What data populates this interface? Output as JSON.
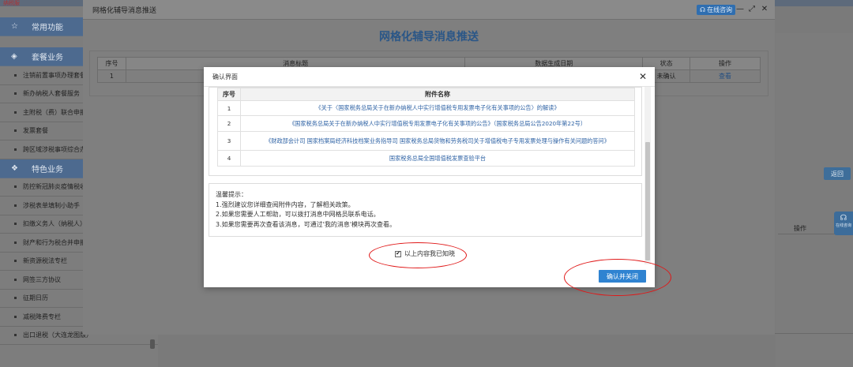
{
  "topbar": {
    "brand_fragment": "纳税服"
  },
  "sidebar": {
    "groups": [
      {
        "label": "常用功能",
        "icon": "star-icon"
      },
      {
        "label": "套餐业务",
        "icon": "package-icon"
      },
      {
        "label": "特色业务",
        "icon": "settings-icon"
      }
    ],
    "package_items": [
      "注销前置事项办理套餐",
      "新办纳税人套餐服务",
      "主附税（费）联合申报",
      "发票套餐",
      "跨区域涉税事项综合办"
    ],
    "feature_items": [
      "防控新冠肺炎疫情税收",
      "涉税表单填制小助手",
      "扣缴义务人（纳税人）",
      "财产和行为税合并申报",
      "新资源税法专栏",
      "网签三方协议",
      "征期日历",
      "减税降费专栏",
      "出口退税（大连龙图版）"
    ]
  },
  "right_panel": {
    "back_label": "返回",
    "action_label": "操作",
    "online_service_label": "在线咨询"
  },
  "outer_modal": {
    "title": "网格化辅导消息推送",
    "online_label": "在线咨询",
    "heading": "网格化辅导消息推送",
    "table": {
      "headers": [
        "序号",
        "消息标题",
        "数据生成日期",
        "状态",
        "操作"
      ],
      "rows": [
        [
          "1",
          "",
          "",
          "未确认",
          "查看"
        ]
      ]
    }
  },
  "confirm_dialog": {
    "title": "确认界面",
    "attachments": {
      "headers": [
        "序号",
        "附件名称"
      ],
      "rows": [
        [
          "1",
          "《关于〈国家税务总局关于在新办纳税人中实行增值税专用发票电子化有关事项的公告〉的解读》"
        ],
        [
          "2",
          "《国家税务总局关于在新办纳税人中实行增值税专用发票电子化有关事项的公告》（国家税务总局公告2020年第22号）"
        ],
        [
          "3",
          "《财政部会计司 国家档案局经济科技档案业务指导司 国家税务总局货物和劳务税司关于增值税电子专用发票处理与操作有关问题的答问》"
        ],
        [
          "4",
          "国家税务总局全国增值税发票查验平台"
        ]
      ]
    },
    "tips": [
      "温馨提示：",
      "1.强烈建议您详细查阅附件内容，了解相关政策。",
      "2.如果您需要人工帮助，可以拨打消息中网格员联系电话。",
      "3.如果您需要再次查看该消息，可通过'我的消息'模块再次查看。"
    ],
    "ack_label": "以上内容我已知晓",
    "ack_checked": "✔",
    "confirm_label": "确认并关闭"
  }
}
